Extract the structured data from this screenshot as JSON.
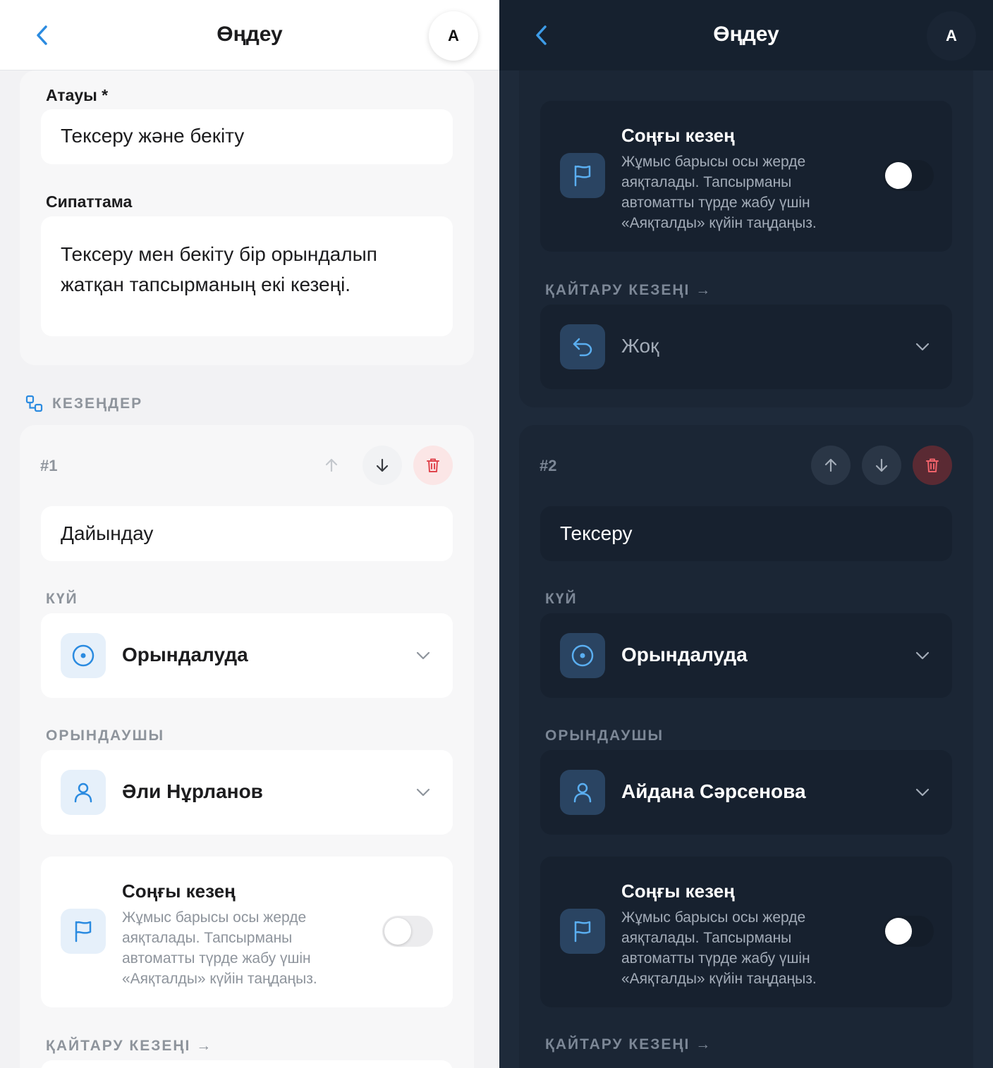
{
  "header": {
    "title": "Өңдеу",
    "avatar": "A"
  },
  "form": {
    "name_label": "Атауы *",
    "name_value": "Тексеру және бекіту",
    "description_label": "Сипаттама",
    "description_line1": "Тексеру мен бекіту бір орындалып",
    "description_line2": "жатқан тапсырманың екі кезеңі."
  },
  "stages_section": {
    "title": "КЕЗЕҢДЕР",
    "icon": "stages-icon"
  },
  "labels": {
    "status": "КҮЙ",
    "assignee": "ОРЫНДАУШЫ",
    "final_title": "Соңғы кезең",
    "final_desc": "Жұмыс барысы осы жерде аяқталады. Тапсырманы автоматты түрде жабу үшін «Аяқталды» күйін таңдаңыз.",
    "return_stage": "ҚАЙТАРУ КЕЗЕҢІ →"
  },
  "stage1": {
    "number": "#1",
    "name": "Дайындау",
    "status": "Орындалуда",
    "assignee": "Әли Нұрланов",
    "final_enabled": false
  },
  "stage_prev_dark": {
    "final_enabled": false,
    "return_value": "Жоқ"
  },
  "stage2": {
    "number": "#2",
    "name": "Тексеру",
    "status": "Орындалуда",
    "assignee": "Айдана Сәрсенова",
    "final_enabled": false
  },
  "colors": {
    "accent": "#2b8be0",
    "danger": "#e0464e",
    "dark_bg": "#1e2a3a",
    "light_bg": "#f2f2f4"
  }
}
